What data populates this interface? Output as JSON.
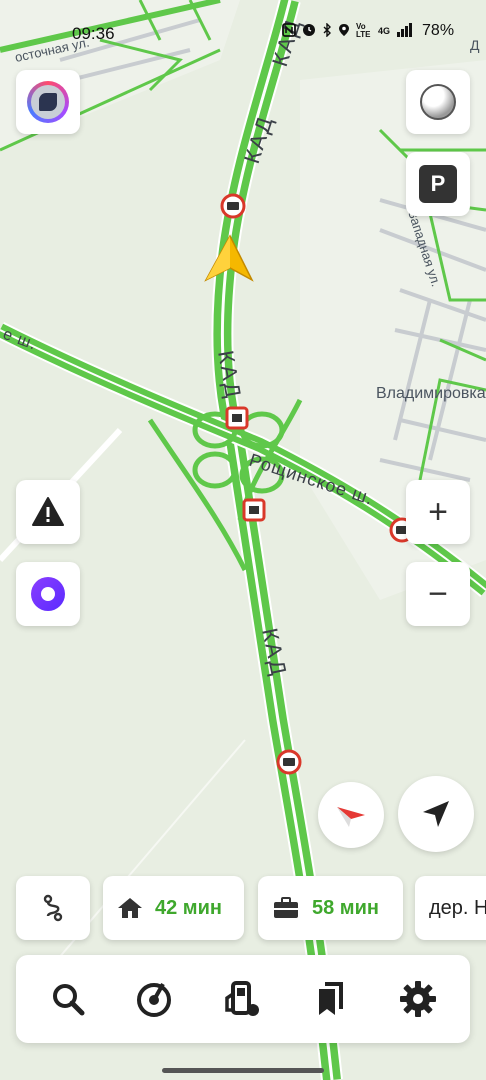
{
  "status_bar": {
    "time": "09:36",
    "icons": [
      "nfc-icon",
      "alarm-icon",
      "bluetooth-icon",
      "location-icon",
      "volte-icon",
      "signal-icon"
    ],
    "network": "4G",
    "volte": "Vo LTE",
    "battery": "78%"
  },
  "map": {
    "labels": {
      "kad_1": "КАД",
      "kad_2": "КАД",
      "kad_3": "КАД",
      "kad_4": "КАД",
      "roshchinskoe": "Рощинское ш.",
      "sh_left": "е ш.",
      "vladimirovka": "Владимировка",
      "zapadnaya": "Западная ул.",
      "vostochnaya": "осточная ул.",
      "top_right_partial": "Д"
    },
    "colors": {
      "background": "#e8eee2",
      "road_traffic": "#5fc84a",
      "arrow": "#f5b800",
      "camera_ring": "#d9382a"
    }
  },
  "controls": {
    "parking_label": "P",
    "zoom_in": "+",
    "zoom_out": "−"
  },
  "shortcuts": [
    {
      "icon": "route-icon",
      "time": "",
      "label": ""
    },
    {
      "icon": "home-icon",
      "time": "42 мин"
    },
    {
      "icon": "work-icon",
      "time": "58 мин"
    },
    {
      "icon": "",
      "place": "дер. Н"
    }
  ],
  "toolbar": {
    "items": [
      "search-icon",
      "music-icon",
      "fuel-icon",
      "bookmarks-icon",
      "settings-icon"
    ]
  }
}
